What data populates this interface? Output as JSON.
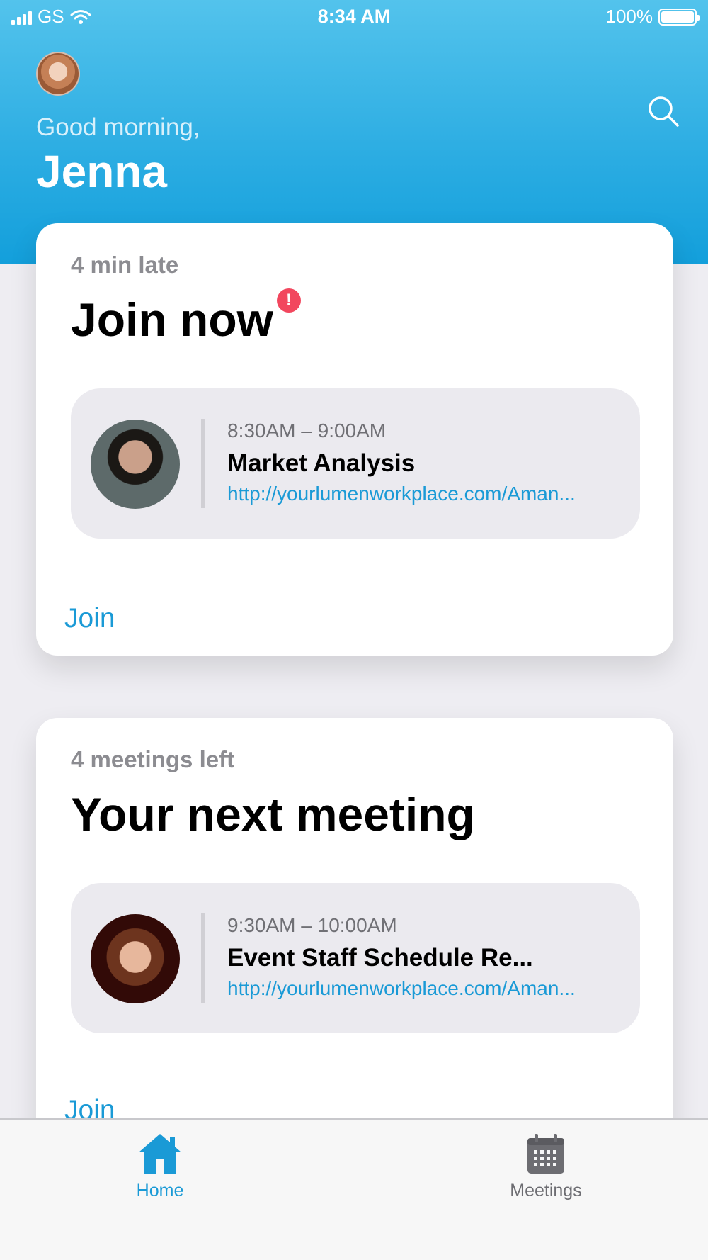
{
  "status_bar": {
    "carrier": "GS",
    "time": "8:34 AM",
    "battery_percent": "100%",
    "battery_level": 1.0
  },
  "header": {
    "greeting": "Good morning,",
    "user_name": "Jenna",
    "search_icon": "search-icon"
  },
  "cards": [
    {
      "subtitle": "4 min late",
      "title": "Join now",
      "alert_badge": "!",
      "meeting": {
        "time": "8:30AM – 9:00AM",
        "title": "Market Analysis",
        "link": "http://yourlumenworkplace.com/Aman..."
      },
      "action": "Join"
    },
    {
      "subtitle": "4 meetings left",
      "title": "Your next meeting",
      "meeting": {
        "time": "9:30AM – 10:00AM",
        "title": "Event Staff Schedule Re...",
        "link": "http://yourlumenworkplace.com/Aman..."
      },
      "action": "Join"
    }
  ],
  "tab_bar": {
    "items": [
      {
        "label": "Home",
        "icon": "home-icon",
        "active": true
      },
      {
        "label": "Meetings",
        "icon": "calendar-icon",
        "active": false
      }
    ]
  },
  "colors": {
    "accent": "#1a9ad6",
    "header_top": "#53c3ec",
    "header_bottom": "#139fdb",
    "alert": "#f2475e"
  }
}
